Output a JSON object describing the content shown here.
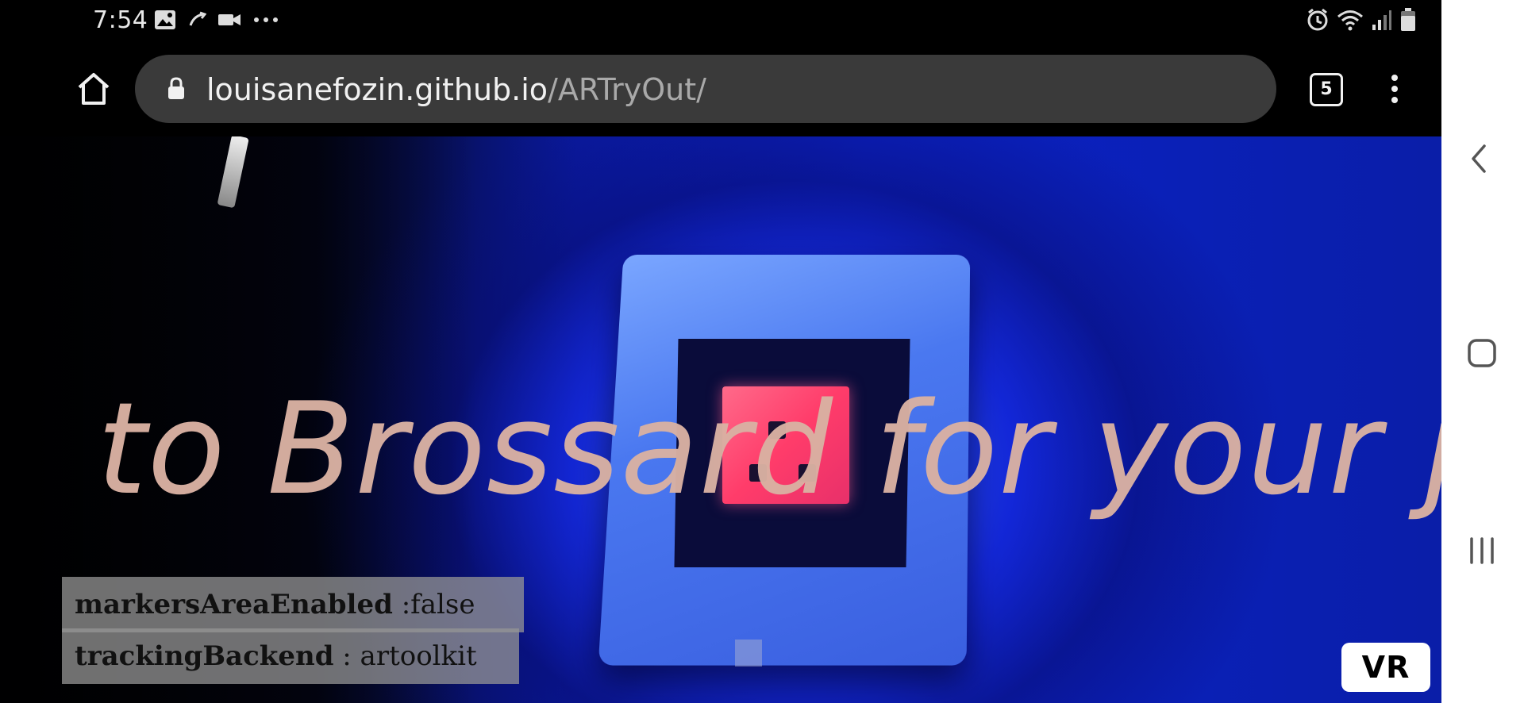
{
  "status_bar": {
    "time": "7:54",
    "left_icons": [
      "image-icon",
      "screen-mirror-icon",
      "video-call-icon",
      "more-notifications-icon"
    ],
    "right_icons": [
      "alarm-icon",
      "wifi-icon",
      "signal-icon",
      "battery-icon"
    ]
  },
  "browser": {
    "url_host": "louisanefozin.github.io",
    "url_path": "/ARTryOut/",
    "tab_count": "5"
  },
  "ar_scene": {
    "overlay_text": "to Brossard for your job?"
  },
  "debug": {
    "markers_area_key": "markersAreaEnabled",
    "markers_area_value": " :false",
    "tracking_backend_key": "trackingBackend",
    "tracking_backend_value": " : artoolkit"
  },
  "vr_button": {
    "label": "VR"
  },
  "colors": {
    "url_pill": "#3a3a3a",
    "ar_text": "#d9b1a3",
    "debug_panel": "#969696"
  }
}
